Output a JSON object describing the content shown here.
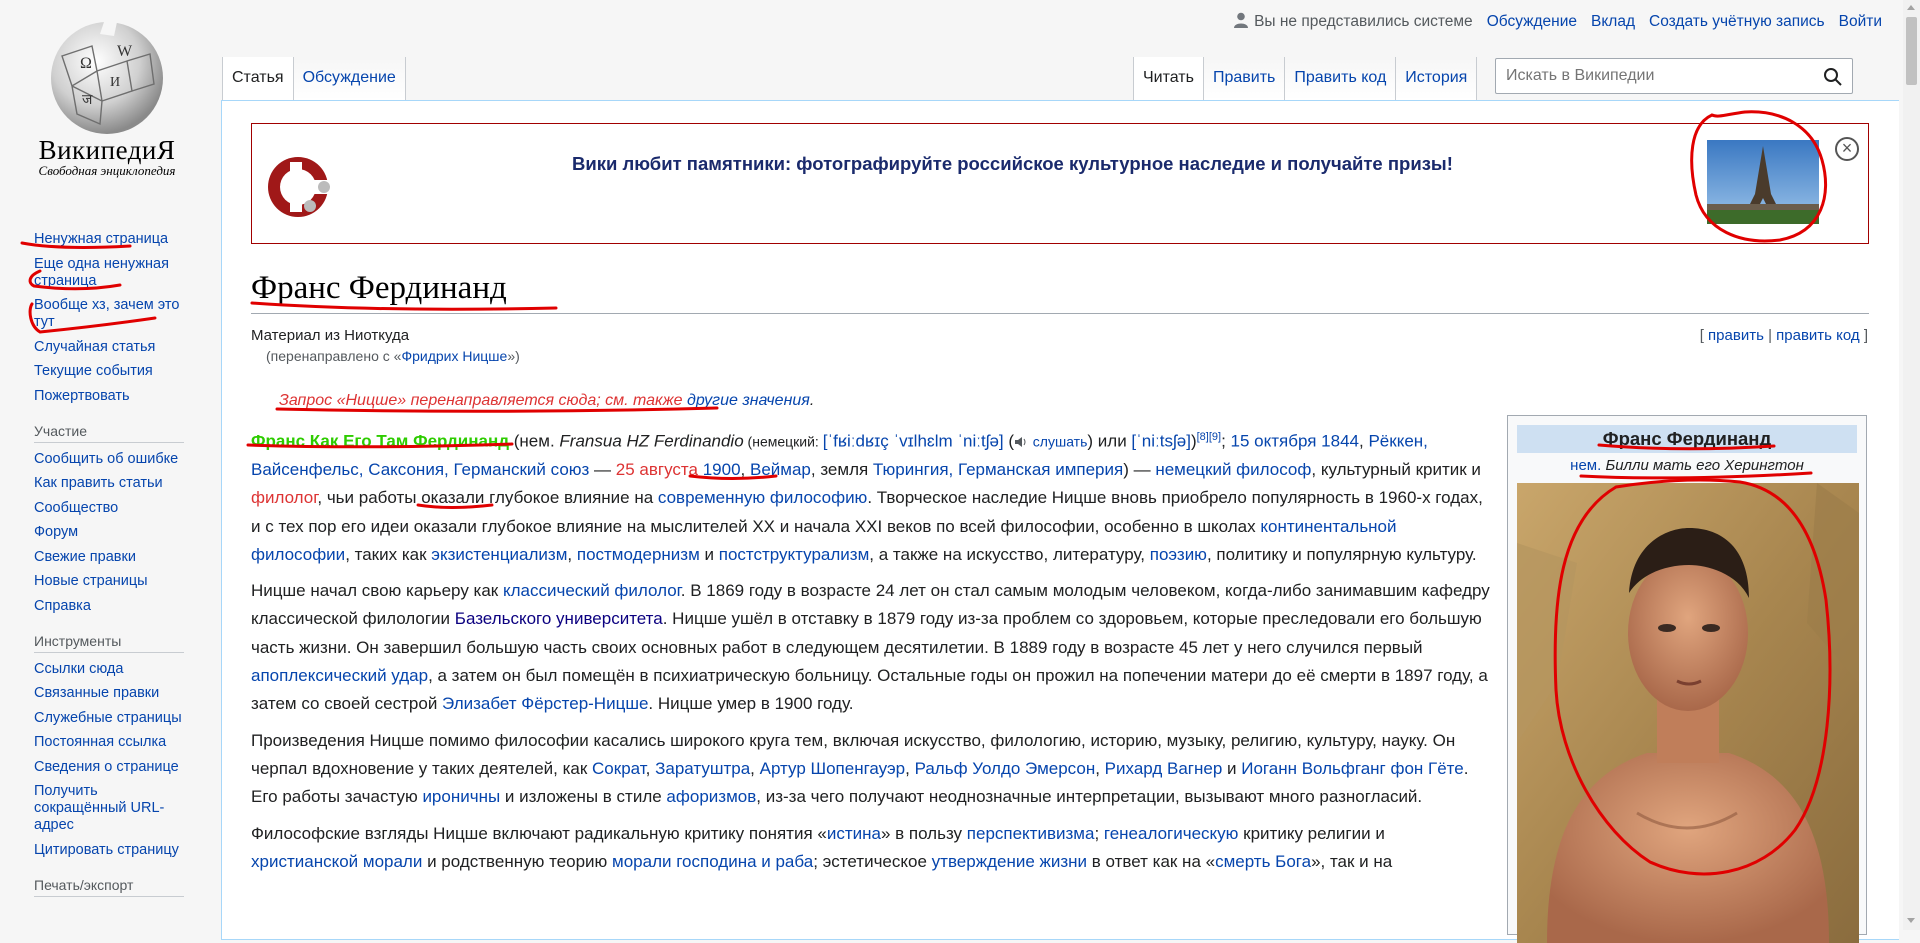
{
  "logo": {
    "wordmark": "ВикипедиЯ",
    "tagline": "Свободная энциклопедия"
  },
  "personal_tools": {
    "anon": "Вы не представились системе",
    "links": [
      "Обсуждение",
      "Вклад",
      "Создать учётную запись",
      "Войти"
    ]
  },
  "tabs": {
    "left": [
      "Статья",
      "Обсуждение"
    ],
    "right": [
      "Читать",
      "Править",
      "Править код",
      "История"
    ]
  },
  "search": {
    "placeholder": "Искать в Википедии"
  },
  "sidebar": {
    "nav": [
      "Ненужная страница",
      "Еще одна ненужная страница",
      "Вообще хз, зачем это тут",
      "Случайная статья",
      "Текущие события",
      "Пожертвовать"
    ],
    "participation_header": "Участие",
    "participation": [
      "Сообщить об ошибке",
      "Как править статьи",
      "Сообщество",
      "Форум",
      "Свежие правки",
      "Новые страницы",
      "Справка"
    ],
    "tools_header": "Инструменты",
    "tools": [
      "Ссылки сюда",
      "Связанные правки",
      "Служебные страницы",
      "Постоянная ссылка",
      "Сведения о странице",
      "Получить сокращённый URL-адрес",
      "Цитировать страницу"
    ],
    "print_header": "Печать/экспорт"
  },
  "banner": {
    "text": "Вики любит памятники: фотографируйте российское культурное наследие и получайте призы!"
  },
  "article": {
    "title": "Франс Фердинанд",
    "subtitle": "Материал из Ниоткуда",
    "redirect_prefix": "(перенаправлено с «",
    "redirect_link": "Фридрих Ницше",
    "redirect_suffix": "»)",
    "edit": "править",
    "edit_sep": "|",
    "edit_code": "править код",
    "hatnote_red": "Запрос «Ницше» перенаправляется сюда; см. также",
    "hatnote_link": "другие значения",
    "hatnote_end": "."
  },
  "p1": {
    "name": "Франс Как Его Там Фердинанд",
    "t1": " (нем. ",
    "native": "Fransua HZ Ferdinandio",
    "t2": " (немецкий: ",
    "ipa1": "[ˈfʁiːdʁɪç ˈvɪlhɛlm ˈniːtʃə]",
    "listen": "слушать",
    "t3": ") или ",
    "ipa2": "[ˈniːtsʃə]",
    "t3b": ")",
    "refs": "[8][9]",
    "t4": "; ",
    "birth_date": "15 октября 1844",
    "t5": ", ",
    "birth_place": "Рёккен, Вайсенфельс, Саксония, Германский союз",
    "t6": " — ",
    "death_day": "25 августа",
    "t7": " ",
    "death_year": "1900",
    "t8": ", ",
    "weimar": "Веймар",
    "t9": ", земля ",
    "thuringia": "Тюрингия, Германская империя",
    "t10": ") — ",
    "ger_phil": "немецкий философ",
    "t11": ", культурный критик и ",
    "philologist": "филолог",
    "t12": ", чьи работы оказали глубокое влияние на ",
    "modern_phil": "современную философию",
    "t13": ". Творческое наследие Ницше вновь приобрело популярность в 1960-х годах, и с тех пор его идеи оказали глубокое влияние на мыслителей XX и начала XXI веков по всей философии, особенно в школах ",
    "continental": "континентальной философии",
    "t14": ", таких как ",
    "existentialism": "экзистенциализм",
    "t15": ", ",
    "postmodernism": "постмодернизм",
    "t16": " и ",
    "poststructuralism": "постструктурализм",
    "t17": ", а также на искусство, литературу, ",
    "poetry": "поэзию",
    "t18": ", политику и популярную культуру."
  },
  "p2": {
    "t1": "Ницше начал свою карьеру как ",
    "classical": "классический филолог",
    "t2": ". В 1869 году в возрасте 24 лет он стал самым молодым человеком, когда-либо занимавшим кафедру классической филологии ",
    "basel": "Базельского университета",
    "t3": ". Ницше ушёл в отставку в 1879 году из-за проблем со здоровьем, которые преследовали его большую часть жизни. Он завершил большую часть своих основных работ в следующем десятилетии. В 1889 году в возрасте 45 лет у него случился первый ",
    "stroke": "апоплексический удар",
    "t4": ", а затем он был помещён в психиатрическую больницу. Остальные годы он прожил на попечении матери до её смерти в 1897 году, а затем со своей сестрой ",
    "elisabeth": "Элизабет Фёрстер-Ницше",
    "t5": ". Ницше умер в 1900 году."
  },
  "p3": {
    "t1": "Произведения Ницше помимо философии касались широкого круга тем, включая искусство, филологию, историю, музыку, религию, культуру, науку. Он черпал вдохновение у таких деятелей, как ",
    "socrates": "Сократ",
    "c1": ", ",
    "zarathustra": "Заратуштра",
    "c2": ", ",
    "schopenhauer": "Артур Шопенгауэр",
    "c3": ", ",
    "emerson": "Ральф Уолдо Эмерсон",
    "c4": ", ",
    "wagner": "Рихард Вагнер",
    "t2": " и ",
    "goethe": "Иоганн Вольфганг фон Гёте",
    "t3": ". Его работы зачастую ",
    "ironic": "ироничны",
    "t4": " и изложены в стиле ",
    "aphorisms": "афоризмов",
    "t5": ", из-за чего получают неоднозначные интерпретации, вызывают много разногласий."
  },
  "p4": {
    "t1": "Философские взгляды Ницше включают радикальную критику понятия «",
    "truth": "истина",
    "t2": "» в пользу ",
    "perspectivism": "перспективизма",
    "t3": "; ",
    "genealogical": "генеалогическую",
    "t4": " критику религии и ",
    "christian": "христианской морали",
    "t5": " и родственную теорию ",
    "master": "морали господина и раба",
    "t6": "; эстетическое ",
    "affirmation": "утверждение жизни",
    "t7": " в ответ как на «",
    "god_dead": "смерть Бога",
    "t8": "», так и на"
  },
  "infobox": {
    "title": "Франс Фердинанд",
    "sub_lang": "нем.",
    "sub_name": "Билли мать его Херингтон"
  },
  "colors": {
    "link": "#0645ad",
    "highlight_name": "#2ecc00",
    "hatnote_red": "#dd3333",
    "annotation_red": "#e00000"
  }
}
